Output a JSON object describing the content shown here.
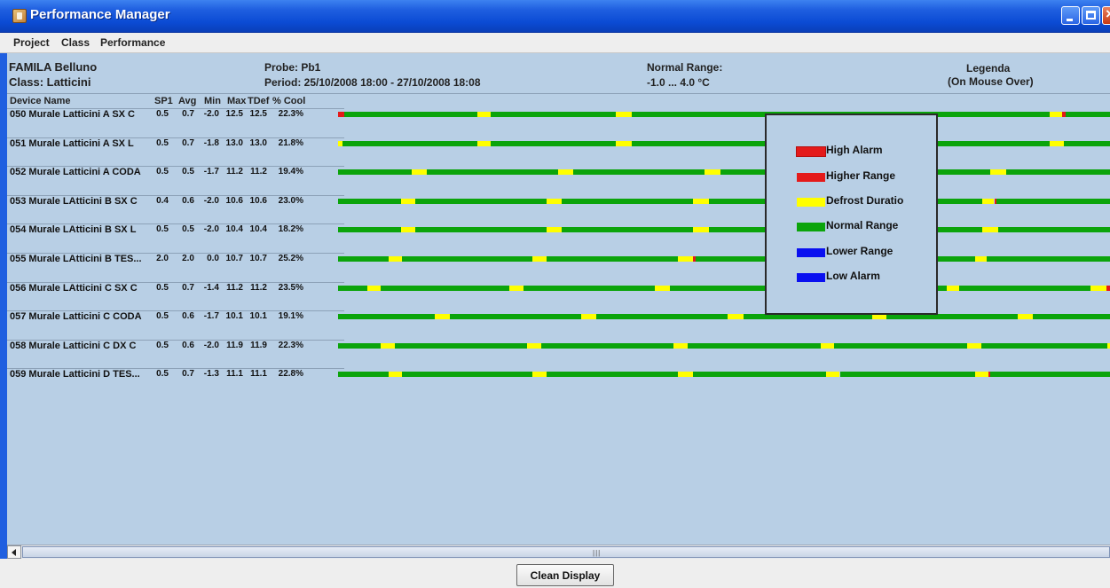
{
  "window": {
    "title": "Performance Manager"
  },
  "menu": [
    "Project",
    "Class",
    "Performance"
  ],
  "header": {
    "site": "FAMILA Belluno",
    "class_label": "Class: Latticini",
    "probe_label": "Probe: Pb1",
    "period_label": "Period:  25/10/2008 18:00  - 27/10/2008 18:08",
    "normal_range_title": "Normal Range:",
    "normal_range_value": "-1.0 ... 4.0 °C",
    "legenda_title": "Legenda",
    "legenda_hint": "(On Mouse Over)"
  },
  "columns": {
    "device": "Device Name",
    "sp1": "SP1",
    "avg": "Avg",
    "min": "Min",
    "max": "Max",
    "tdef": "TDef",
    "cool": "% Cool"
  },
  "devices": [
    {
      "name": "050 Murale Latticini A SX C",
      "sp1": "0.5",
      "avg": "0.7",
      "min": "-2.0",
      "max": "12.5",
      "tdef": "12.5",
      "cool": "22.3%",
      "timeline": [
        [
          "r",
          0,
          0.8
        ],
        [
          "g",
          0.8,
          18
        ],
        [
          "y",
          18,
          19.8
        ],
        [
          "g",
          19.8,
          36
        ],
        [
          "y",
          36,
          38
        ],
        [
          "g",
          38,
          92.2
        ],
        [
          "y",
          92.2,
          93.8
        ],
        [
          "r",
          93.8,
          94.2
        ],
        [
          "g",
          94.2,
          100
        ]
      ]
    },
    {
      "name": "051 Murale Latticini A SX L",
      "sp1": "0.5",
      "avg": "0.7",
      "min": "-1.8",
      "max": "13.0",
      "tdef": "13.0",
      "cool": "21.8%",
      "timeline": [
        [
          "y",
          0,
          0.6
        ],
        [
          "g",
          0.6,
          18
        ],
        [
          "y",
          18,
          19.8
        ],
        [
          "g",
          19.8,
          36
        ],
        [
          "y",
          36,
          38
        ],
        [
          "g",
          38,
          92.2
        ],
        [
          "y",
          92.2,
          94
        ],
        [
          "g",
          94,
          100
        ]
      ]
    },
    {
      "name": "052 Murale Latticini A CODA",
      "sp1": "0.5",
      "avg": "0.5",
      "min": "-1.7",
      "max": "11.2",
      "tdef": "11.2",
      "cool": "19.4%",
      "timeline": [
        [
          "g",
          0,
          9.5
        ],
        [
          "y",
          9.5,
          11.5
        ],
        [
          "g",
          11.5,
          28.5
        ],
        [
          "y",
          28.5,
          30.5
        ],
        [
          "g",
          30.5,
          47.5
        ],
        [
          "y",
          47.5,
          49.5
        ],
        [
          "g",
          49.5,
          84.5
        ],
        [
          "y",
          84.5,
          86.5
        ],
        [
          "g",
          86.5,
          100
        ]
      ]
    },
    {
      "name": "053 Murale LAtticini B SX C",
      "sp1": "0.4",
      "avg": "0.6",
      "min": "-2.0",
      "max": "10.6",
      "tdef": "10.6",
      "cool": "23.0%",
      "timeline": [
        [
          "g",
          0,
          8.2
        ],
        [
          "y",
          8.2,
          10
        ],
        [
          "g",
          10,
          27
        ],
        [
          "y",
          27,
          29
        ],
        [
          "g",
          29,
          46
        ],
        [
          "y",
          46,
          48
        ],
        [
          "g",
          48,
          83.5
        ],
        [
          "y",
          83.5,
          85
        ],
        [
          "r",
          85,
          85.3
        ],
        [
          "g",
          85.3,
          100
        ]
      ]
    },
    {
      "name": "054 Murale LAtticini B SX L",
      "sp1": "0.5",
      "avg": "0.5",
      "min": "-2.0",
      "max": "10.4",
      "tdef": "10.4",
      "cool": "18.2%",
      "timeline": [
        [
          "g",
          0,
          8.2
        ],
        [
          "y",
          8.2,
          10
        ],
        [
          "g",
          10,
          27
        ],
        [
          "y",
          27,
          29
        ],
        [
          "g",
          29,
          46
        ],
        [
          "y",
          46,
          48
        ],
        [
          "g",
          48,
          83.5
        ],
        [
          "y",
          83.5,
          85.5
        ],
        [
          "g",
          85.5,
          100
        ]
      ]
    },
    {
      "name": "055 Murale LAtticini B TES...",
      "sp1": "2.0",
      "avg": "2.0",
      "min": "0.0",
      "max": "10.7",
      "tdef": "10.7",
      "cool": "25.2%",
      "timeline": [
        [
          "g",
          0,
          6.5
        ],
        [
          "y",
          6.5,
          8.3
        ],
        [
          "g",
          8.3,
          25.2
        ],
        [
          "y",
          25.2,
          27
        ],
        [
          "g",
          27,
          44
        ],
        [
          "y",
          44,
          46
        ],
        [
          "r",
          46,
          46.3
        ],
        [
          "g",
          46.3,
          63.2
        ],
        [
          "y",
          63.2,
          65
        ],
        [
          "g",
          65,
          82.5
        ],
        [
          "y",
          82.5,
          84
        ],
        [
          "g",
          84,
          100
        ]
      ]
    },
    {
      "name": "056 Murale LAtticini C SX C",
      "sp1": "0.5",
      "avg": "0.7",
      "min": "-1.4",
      "max": "11.2",
      "tdef": "11.2",
      "cool": "23.5%",
      "timeline": [
        [
          "g",
          0,
          3.8
        ],
        [
          "y",
          3.8,
          5.5
        ],
        [
          "g",
          5.5,
          22.2
        ],
        [
          "y",
          22.2,
          24
        ],
        [
          "g",
          24,
          41
        ],
        [
          "y",
          41,
          43
        ],
        [
          "g",
          43,
          59.8
        ],
        [
          "y",
          59.8,
          61.5
        ],
        [
          "g",
          61.5,
          78.8
        ],
        [
          "y",
          78.8,
          80.5
        ],
        [
          "g",
          80.5,
          97.5
        ],
        [
          "y",
          97.5,
          99.5
        ],
        [
          "r",
          99.5,
          100
        ]
      ]
    },
    {
      "name": "057 Murale Latticini C CODA",
      "sp1": "0.5",
      "avg": "0.6",
      "min": "-1.7",
      "max": "10.1",
      "tdef": "10.1",
      "cool": "19.1%",
      "timeline": [
        [
          "g",
          0,
          12.5
        ],
        [
          "y",
          12.5,
          14.5
        ],
        [
          "g",
          14.5,
          31.5
        ],
        [
          "y",
          31.5,
          33.5
        ],
        [
          "g",
          33.5,
          50.5
        ],
        [
          "y",
          50.5,
          52.5
        ],
        [
          "g",
          52.5,
          69.2
        ],
        [
          "y",
          69.2,
          71
        ],
        [
          "g",
          71,
          88
        ],
        [
          "y",
          88,
          90
        ],
        [
          "g",
          90,
          100
        ]
      ]
    },
    {
      "name": "058 Murale Latticini C DX C",
      "sp1": "0.5",
      "avg": "0.6",
      "min": "-2.0",
      "max": "11.9",
      "tdef": "11.9",
      "cool": "22.3%",
      "timeline": [
        [
          "g",
          0,
          5.5
        ],
        [
          "y",
          5.5,
          7.3
        ],
        [
          "g",
          7.3,
          24.5
        ],
        [
          "y",
          24.5,
          26.3
        ],
        [
          "g",
          26.3,
          43.5
        ],
        [
          "y",
          43.5,
          45.3
        ],
        [
          "g",
          45.3,
          62.5
        ],
        [
          "y",
          62.5,
          64.3
        ],
        [
          "g",
          64.3,
          81.5
        ],
        [
          "y",
          81.5,
          83.3
        ],
        [
          "g",
          83.3,
          99.7
        ],
        [
          "y",
          99.7,
          100
        ]
      ]
    },
    {
      "name": "059 Murale Latticini D TES...",
      "sp1": "0.5",
      "avg": "0.7",
      "min": "-1.3",
      "max": "11.1",
      "tdef": "11.1",
      "cool": "22.8%",
      "timeline": [
        [
          "g",
          0,
          6.5
        ],
        [
          "y",
          6.5,
          8.3
        ],
        [
          "g",
          8.3,
          25.2
        ],
        [
          "y",
          25.2,
          27
        ],
        [
          "g",
          27,
          44
        ],
        [
          "y",
          44,
          46
        ],
        [
          "g",
          46,
          63.2
        ],
        [
          "y",
          63.2,
          65
        ],
        [
          "g",
          65,
          82.5
        ],
        [
          "y",
          82.5,
          84.2
        ],
        [
          "r",
          84.2,
          84.5
        ],
        [
          "g",
          84.5,
          100
        ]
      ]
    }
  ],
  "legend": [
    {
      "label": "High Alarm",
      "color": "#e41a1a",
      "outlined": true
    },
    {
      "label": "Higher Range",
      "color": "#e41a1a",
      "outlined": false
    },
    {
      "label": "Defrost Duratio",
      "color": "#ffff00",
      "outlined": false
    },
    {
      "label": "Normal Range",
      "color": "#0ba40b",
      "outlined": false
    },
    {
      "label": "Lower Range",
      "color": "#0a10f0",
      "outlined": false
    },
    {
      "label": "Low Alarm",
      "color": "#0a10f0",
      "outlined": false
    }
  ],
  "colors": {
    "g": "#0ba40b",
    "y": "#ffff00",
    "r": "#e41a1a"
  },
  "footer": {
    "button": "Clean Display"
  }
}
